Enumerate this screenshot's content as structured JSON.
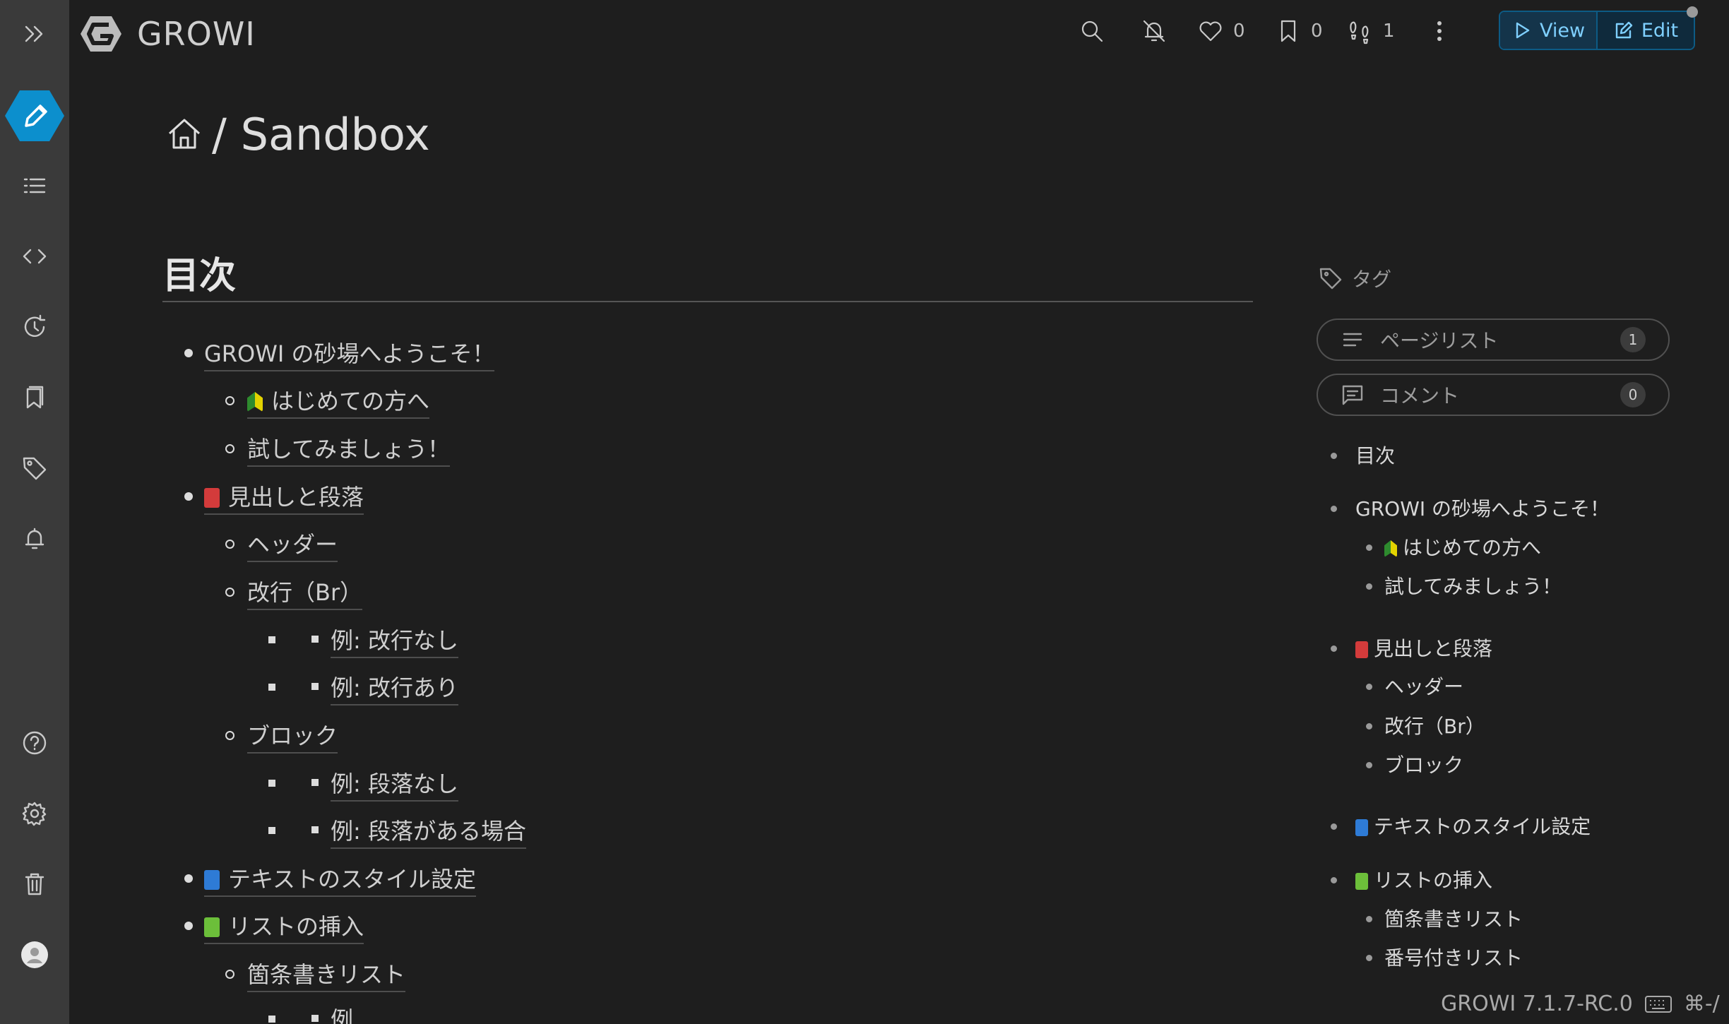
{
  "app": {
    "name": "GROWI",
    "version": "GROWI 7.1.7-RC.0",
    "shortcut": "⌘-/"
  },
  "header": {
    "like_count": "0",
    "bookmark_count": "0",
    "seen_count": "1",
    "view_label": "View",
    "edit_label": "Edit"
  },
  "page": {
    "title": "/ Sandbox"
  },
  "toc": {
    "heading": "目次",
    "items": [
      {
        "text": "GROWI の砂場へようこそ！",
        "emoji": ""
      },
      {
        "text": "はじめての方へ",
        "emoji": "green"
      },
      {
        "text": "試してみましょう！",
        "emoji": ""
      },
      {
        "text": "見出しと段落",
        "emoji": "red"
      },
      {
        "text": "ヘッダー",
        "emoji": ""
      },
      {
        "text": "改行（Br）",
        "emoji": ""
      },
      {
        "text": "例: 改行なし",
        "emoji": ""
      },
      {
        "text": "例: 改行あり",
        "emoji": ""
      },
      {
        "text": "ブロック",
        "emoji": ""
      },
      {
        "text": "例: 段落なし",
        "emoji": ""
      },
      {
        "text": "例: 段落がある場合",
        "emoji": ""
      },
      {
        "text": "テキストのスタイル設定",
        "emoji": "blue"
      },
      {
        "text": "リストの挿入",
        "emoji": "lgreen"
      },
      {
        "text": "箇条書きリスト",
        "emoji": ""
      },
      {
        "text": "例",
        "emoji": ""
      }
    ]
  },
  "side": {
    "tag_label": "タグ",
    "page_list_label": "ページリスト",
    "page_list_count": "1",
    "comment_label": "コメント",
    "comment_count": "0",
    "toc": [
      "目次",
      "GROWI の砂場へようこそ！",
      "はじめての方へ",
      "試してみましょう！",
      "見出しと段落",
      "ヘッダー",
      "改行（Br）",
      "ブロック",
      "テキストのスタイル設定",
      "リストの挿入",
      "箇条書きリスト",
      "番号付きリスト"
    ]
  },
  "colors": {
    "accent": "#0ea5e9",
    "background": "#1e1e1e",
    "sidebar": "#3a3a3a",
    "link": "#7fd0ff"
  },
  "icons": [
    "sidebar-collapse-icon",
    "edit-icon",
    "list-icon",
    "code-icon",
    "history-icon",
    "bookmarks-icon",
    "tag-icon",
    "bell-icon",
    "help-icon",
    "gear-icon",
    "trash-icon",
    "user-icon",
    "search-icon",
    "bell-off-icon",
    "heart-icon",
    "bookmark-icon",
    "footprints-icon",
    "more-icon",
    "home-icon",
    "keyboard-icon"
  ]
}
